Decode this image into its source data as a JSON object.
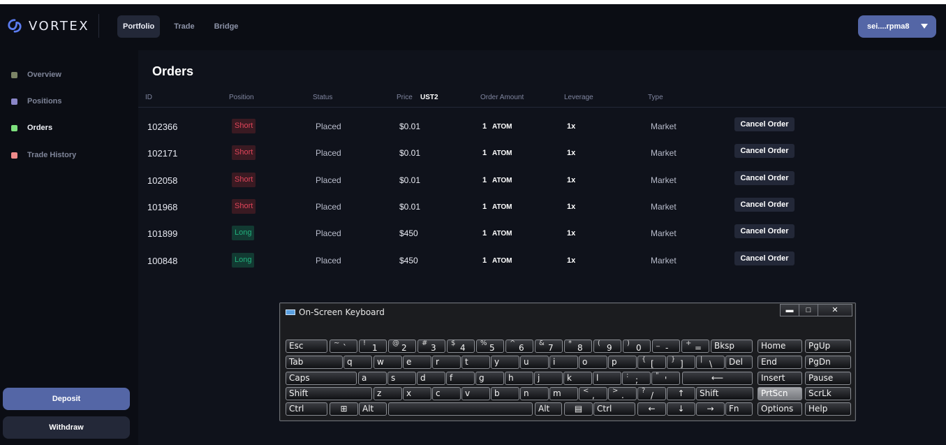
{
  "brand": {
    "name": "VORTEX"
  },
  "nav": [
    {
      "label": "Portfolio",
      "active": true
    },
    {
      "label": "Trade",
      "active": false
    },
    {
      "label": "Bridge",
      "active": false
    }
  ],
  "wallet": {
    "label": "sei....rpma8"
  },
  "sidebar": {
    "items": [
      {
        "label": "Overview",
        "color": "#7c8466",
        "active": false
      },
      {
        "label": "Positions",
        "color": "#8a86c8",
        "active": false
      },
      {
        "label": "Orders",
        "color": "#7ee07e",
        "active": true
      },
      {
        "label": "Trade History",
        "color": "#ee8a8a",
        "active": false
      }
    ],
    "deposit_label": "Deposit",
    "withdraw_label": "Withdraw"
  },
  "orders": {
    "title": "Orders",
    "columns": {
      "id": "ID",
      "position": "Position",
      "status": "Status",
      "price": "Price",
      "price_unit": "UST2",
      "amount": "Order Amount",
      "leverage": "Leverage",
      "type": "Type"
    },
    "cancel_label": "Cancel Order",
    "rows": [
      {
        "id": "102366",
        "position": "Short",
        "status": "Placed",
        "price": "$0.01",
        "amount": "1",
        "unit": "ATOM",
        "leverage": "1x",
        "type": "Market"
      },
      {
        "id": "102171",
        "position": "Short",
        "status": "Placed",
        "price": "$0.01",
        "amount": "1",
        "unit": "ATOM",
        "leverage": "1x",
        "type": "Market"
      },
      {
        "id": "102058",
        "position": "Short",
        "status": "Placed",
        "price": "$0.01",
        "amount": "1",
        "unit": "ATOM",
        "leverage": "1x",
        "type": "Market"
      },
      {
        "id": "101968",
        "position": "Short",
        "status": "Placed",
        "price": "$0.01",
        "amount": "1",
        "unit": "ATOM",
        "leverage": "1x",
        "type": "Market"
      },
      {
        "id": "101899",
        "position": "Long",
        "status": "Placed",
        "price": "$450",
        "amount": "1",
        "unit": "ATOM",
        "leverage": "1x",
        "type": "Market"
      },
      {
        "id": "100848",
        "position": "Long",
        "status": "Placed",
        "price": "$450",
        "amount": "1",
        "unit": "ATOM",
        "leverage": "1x",
        "type": "Market"
      }
    ]
  },
  "keyboard": {
    "title": "On-Screen Keyboard",
    "window_controls": [
      "minimize",
      "restore",
      "close"
    ],
    "rows": [
      [
        {
          "l": "Esc"
        },
        {
          "s": "~",
          "m": "`"
        },
        {
          "s": "!",
          "m": "1"
        },
        {
          "s": "@",
          "m": "2"
        },
        {
          "s": "#",
          "m": "3"
        },
        {
          "s": "$",
          "m": "4"
        },
        {
          "s": "%",
          "m": "5"
        },
        {
          "s": "^",
          "m": "6"
        },
        {
          "s": "&",
          "m": "7"
        },
        {
          "s": "*",
          "m": "8"
        },
        {
          "s": "(",
          "m": "9"
        },
        {
          "s": ")",
          "m": "0"
        },
        {
          "s": "_",
          "m": "-"
        },
        {
          "s": "+",
          "m": "="
        },
        {
          "l": "Bksp"
        },
        {
          "l": "Home"
        },
        {
          "l": "PgUp"
        }
      ],
      [
        {
          "l": "Tab"
        },
        {
          "l": "q"
        },
        {
          "l": "w"
        },
        {
          "l": "e"
        },
        {
          "l": "r"
        },
        {
          "l": "t"
        },
        {
          "l": "y"
        },
        {
          "l": "u"
        },
        {
          "l": "i"
        },
        {
          "l": "o"
        },
        {
          "l": "p"
        },
        {
          "s": "{",
          "m": "["
        },
        {
          "s": "}",
          "m": "]"
        },
        {
          "s": "|",
          "m": "\\"
        },
        {
          "l": "Del"
        },
        {
          "l": "End"
        },
        {
          "l": "PgDn"
        }
      ],
      [
        {
          "l": "Caps"
        },
        {
          "l": "a"
        },
        {
          "l": "s"
        },
        {
          "l": "d"
        },
        {
          "l": "f"
        },
        {
          "l": "g"
        },
        {
          "l": "h"
        },
        {
          "l": "j"
        },
        {
          "l": "k"
        },
        {
          "l": "l"
        },
        {
          "s": ":",
          "m": ";"
        },
        {
          "s": "\"",
          "m": "'"
        },
        {
          "i": "enter"
        },
        {
          "l": "Insert"
        },
        {
          "l": "Pause"
        }
      ],
      [
        {
          "l": "Shift"
        },
        {
          "l": "z"
        },
        {
          "l": "x"
        },
        {
          "l": "c"
        },
        {
          "l": "v"
        },
        {
          "l": "b"
        },
        {
          "l": "n"
        },
        {
          "l": "m"
        },
        {
          "s": "<",
          "m": ","
        },
        {
          "s": ">",
          "m": "."
        },
        {
          "s": "?",
          "m": "/"
        },
        {
          "i": "up"
        },
        {
          "l": "Shift"
        },
        {
          "l": "PrtScn",
          "pressed": true
        },
        {
          "l": "ScrLk"
        }
      ],
      [
        {
          "l": "Ctrl"
        },
        {
          "i": "windows"
        },
        {
          "l": "Alt"
        },
        {
          "i": "space"
        },
        {
          "l": "Alt"
        },
        {
          "i": "menu"
        },
        {
          "l": "Ctrl"
        },
        {
          "i": "left"
        },
        {
          "i": "down"
        },
        {
          "i": "right"
        },
        {
          "l": "Fn"
        },
        {
          "l": "Options"
        },
        {
          "l": "Help"
        }
      ]
    ]
  }
}
